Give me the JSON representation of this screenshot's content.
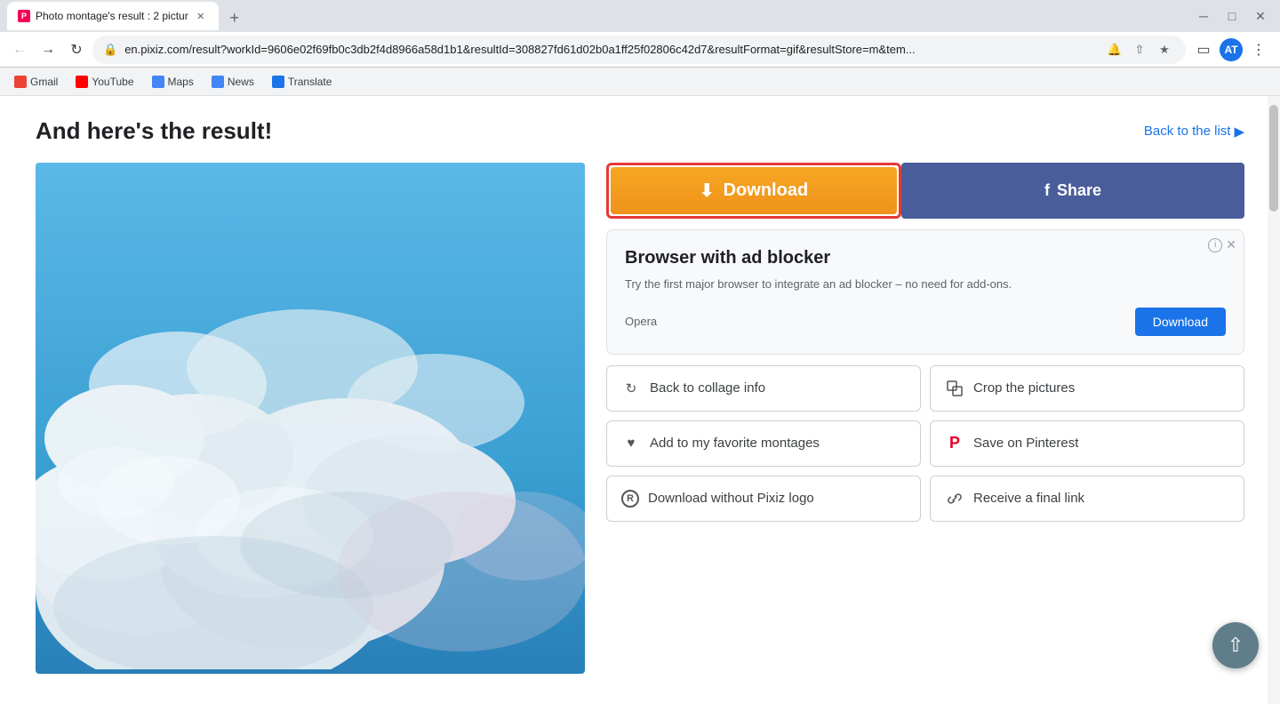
{
  "browser": {
    "tab_title": "Photo montage's result : 2 pictur",
    "tab_favicon_text": "P",
    "url": "en.pixiz.com/result?workId=9606e02f69fb0c3db2f4d8966a58d1b1&resultId=308827fd61d02b0a1ff25f02806c42d7&resultFormat=gif&resultStore=m&tem...",
    "notification_text": "Notifications blocked",
    "window_controls": {
      "minimize": "─",
      "maximize": "□",
      "close": "✕"
    }
  },
  "bookmarks": [
    {
      "id": "gmail",
      "label": "Gmail",
      "type": "gmail"
    },
    {
      "id": "youtube",
      "label": "YouTube",
      "type": "youtube"
    },
    {
      "id": "maps",
      "label": "Maps",
      "type": "maps"
    },
    {
      "id": "news",
      "label": "News",
      "type": "news"
    },
    {
      "id": "translate",
      "label": "Translate",
      "type": "translate"
    }
  ],
  "page": {
    "title": "And here's the result!",
    "back_to_list": "Back to the list",
    "back_to_list_arrow": "▶"
  },
  "actions": {
    "download_label": "Download",
    "share_label": "Share"
  },
  "ad": {
    "title": "Browser with ad blocker",
    "body": "Try the first major browser to integrate an ad blocker – no need for add-ons.",
    "brand": "Opera",
    "download_label": "Download"
  },
  "action_buttons": [
    {
      "id": "back-collage",
      "icon": "↺",
      "label": "Back to collage info"
    },
    {
      "id": "crop-pictures",
      "icon": "⊡",
      "label": "Crop the pictures"
    },
    {
      "id": "favorite",
      "icon": "♥",
      "label": "Add to my favorite montages"
    },
    {
      "id": "pinterest",
      "icon": "𝗣",
      "label": "Save on Pinterest"
    },
    {
      "id": "download-no-logo",
      "icon": "®",
      "label": "Download without Pixiz logo"
    },
    {
      "id": "final-link",
      "icon": "🔗",
      "label": "Receive a final link"
    }
  ],
  "avatar_text": "AT"
}
